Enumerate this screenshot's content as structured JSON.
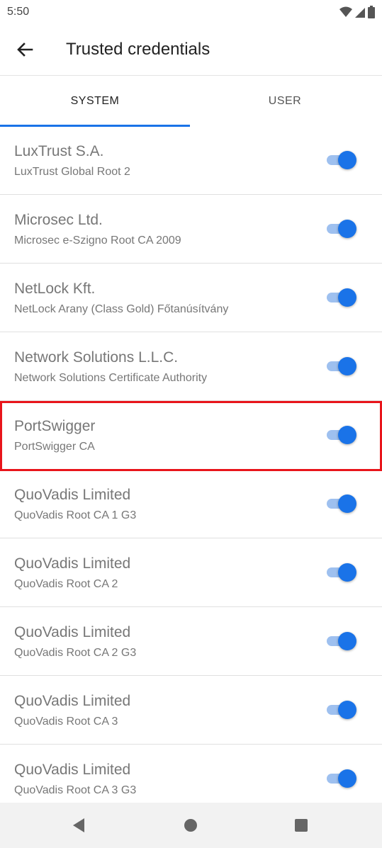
{
  "status": {
    "time": "5:50"
  },
  "appbar": {
    "title": "Trusted credentials"
  },
  "tabs": [
    {
      "label": "SYSTEM",
      "selected": true
    },
    {
      "label": "USER",
      "selected": false
    }
  ],
  "accent_color": "#1a73e8",
  "highlight_color": "#e8151b",
  "certs": [
    {
      "org": "LuxTrust S.A.",
      "name": "LuxTrust Global Root 2",
      "enabled": true
    },
    {
      "org": "Microsec Ltd.",
      "name": "Microsec e-Szigno Root CA 2009",
      "enabled": true
    },
    {
      "org": "NetLock Kft.",
      "name": "NetLock Arany (Class Gold) Főtanúsítvány",
      "enabled": true
    },
    {
      "org": "Network Solutions L.L.C.",
      "name": "Network Solutions Certificate Authority",
      "enabled": true
    },
    {
      "org": "PortSwigger",
      "name": "PortSwigger CA",
      "enabled": true
    },
    {
      "org": "QuoVadis Limited",
      "name": "QuoVadis Root CA 1 G3",
      "enabled": true
    },
    {
      "org": "QuoVadis Limited",
      "name": "QuoVadis Root CA 2",
      "enabled": true
    },
    {
      "org": "QuoVadis Limited",
      "name": "QuoVadis Root CA 2 G3",
      "enabled": true
    },
    {
      "org": "QuoVadis Limited",
      "name": "QuoVadis Root CA 3",
      "enabled": true
    },
    {
      "org": "QuoVadis Limited",
      "name": "QuoVadis Root CA 3 G3",
      "enabled": true
    }
  ],
  "navbar": {
    "icons": [
      "back-icon",
      "home-icon",
      "recents-icon"
    ]
  }
}
